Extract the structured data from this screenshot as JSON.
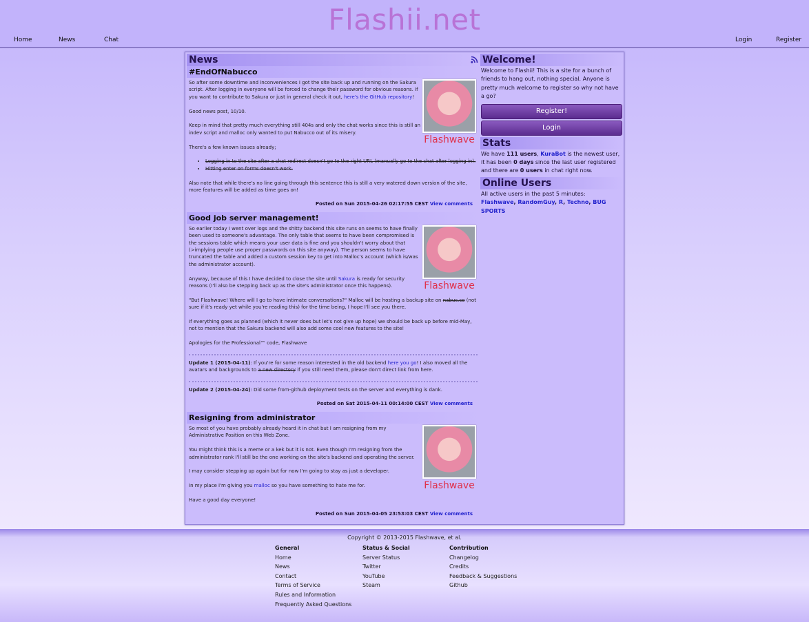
{
  "logo": "Flashii.net",
  "nav": {
    "left": [
      "Home",
      "News",
      "Chat"
    ],
    "right": [
      "Login",
      "Register"
    ]
  },
  "news": {
    "title": "News",
    "rss_icon": "rss-icon",
    "posts": [
      {
        "title": "#EndOfNabucco",
        "p1": "So after some downtime and inconveniences I got the site back up and running on the Sakura script. After logging in everyone will be forced to change their password for obvious reasons. If you want to contribute to Sakura or just in general check it out, ",
        "p1_link": "here's the GitHub repository",
        "p1_end": "!",
        "p2": "Good news post, 10/10.",
        "p3": "Keep in mind that pretty much everything still 404s and only the chat works since this is still an indev script and malloc only wanted to put Nabucco out of its misery.",
        "p4": "There's a few known issues already;",
        "issues": [
          "Logging in to the site after a chat redirect doesn't go to the right URL (manually go to the chat after logging in).",
          "Hitting enter on forms doesn't work."
        ],
        "p5": "Also note that while there's no line going through this sentence this is still a very watered down version of the site, more features will be added as time goes on!",
        "author": "Flashwave",
        "posted_prefix": "Posted on",
        "posted": "Sun 2015-04-26 02:17:55 CEST",
        "comments": "View comments"
      },
      {
        "title": "Good job server management!",
        "p1": "So earlier today I went over logs and the shitty backend this site runs on seems to have finally been used to someone's advantage. The only table that seems to have been compromised is the sessions table which means your user data is fine and you shouldn't worry about that (>implying people use proper passwords on this site anyway). The person seems to have truncated the table and added a custom session key to get into Malloc's account (which is/was the administrator account).",
        "p2a": "Anyway, because of this I have decided to close the site until ",
        "p2_link": "Sakura",
        "p2b": " is ready for security reasons (I'll also be stepping back up as the site's administrator once this happens).",
        "p3a": "\"But Flashwave! Where will I go to have intimate conversations?\" Malloc will be hosting a backup site on ",
        "p3_strike": "nabuc.co",
        "p3b": " (not sure if it's ready yet while you're reading this) for the time being, I hope I'll see you there.",
        "p4": "If everything goes as planned (which it never does but let's not give up hope) we should be back up before mid-May, not to mention that the Sakura backend will also add some cool new features to the site!",
        "p5": "Apologies for the Professional™ code, Flashwave",
        "u1_label": "Update 1 (2015-04-11)",
        "u1a": ": If you're for some reason interested in the old backend ",
        "u1_link": "here you go",
        "u1b": "! I also moved all the avatars and backgrounds to ",
        "u1_strike": "a new directory",
        "u1c": " if you still need them, please don't direct link from here.",
        "u2_label": "Update 2 (2015-04-24)",
        "u2": ": Did some from-github deployment tests on the server and everything is dank.",
        "author": "Flashwave",
        "posted_prefix": "Posted on",
        "posted": "Sat 2015-04-11 00:14:00 CEST",
        "comments": "View comments"
      },
      {
        "title": "Resigning from administrator",
        "p1": "So most of you have probably already heard it in chat but I am resigning from my Administrative Position on this Web Zone.",
        "p2": "You might think this is a meme or a kek but it is not. Even though I'm resigning from the administrator rank I'll still be the one working on the site's backend and operating the server.",
        "p3": "I may consider stepping up again but for now I'm going to stay as just a developer.",
        "p4a": "In my place I'm giving you ",
        "p4_link": "malloc",
        "p4b": " so you have something to hate me for.",
        "p5": "Have a good day everyone!",
        "author": "Flashwave",
        "posted_prefix": "Posted on",
        "posted": "Sun 2015-04-05 23:53:03 CEST",
        "comments": "View comments"
      }
    ]
  },
  "welcome": {
    "title": "Welcome!",
    "text": "Welcome to Flashii! This is a site for a bunch of friends to hang out, nothing special. Anyone is pretty much welcome to register so why not have a go?",
    "register_btn": "Register!",
    "login_btn": "Login"
  },
  "stats": {
    "title": "Stats",
    "t1": "We have ",
    "users": "111 users",
    "t2": ", ",
    "newest": "KuraBot",
    "t3": " is the newest user, it has been ",
    "days": "0 days",
    "t4": " since the last user registered and there are ",
    "chat_users": "0 users",
    "t5": " in chat right now."
  },
  "online": {
    "title": "Online Users",
    "text": "All active users in the past 5 minutes:",
    "users": [
      "Flashwave",
      "RandomGuy",
      "R",
      "Techno",
      "BUG SPORTS"
    ]
  },
  "footer": {
    "copyright": "Copyright © 2013-2015 Flashwave, et al.",
    "general": {
      "title": "General",
      "items": [
        "Home",
        "News",
        "Contact",
        "Terms of Service",
        "Rules and Information",
        "Frequently Asked Questions"
      ]
    },
    "status": {
      "title": "Status & Social",
      "items": [
        "Server Status",
        "Twitter",
        "YouTube",
        "Steam"
      ]
    },
    "contribution": {
      "title": "Contribution",
      "items": [
        "Changelog",
        "Credits",
        "Feedback & Suggestions",
        "Github"
      ]
    }
  }
}
